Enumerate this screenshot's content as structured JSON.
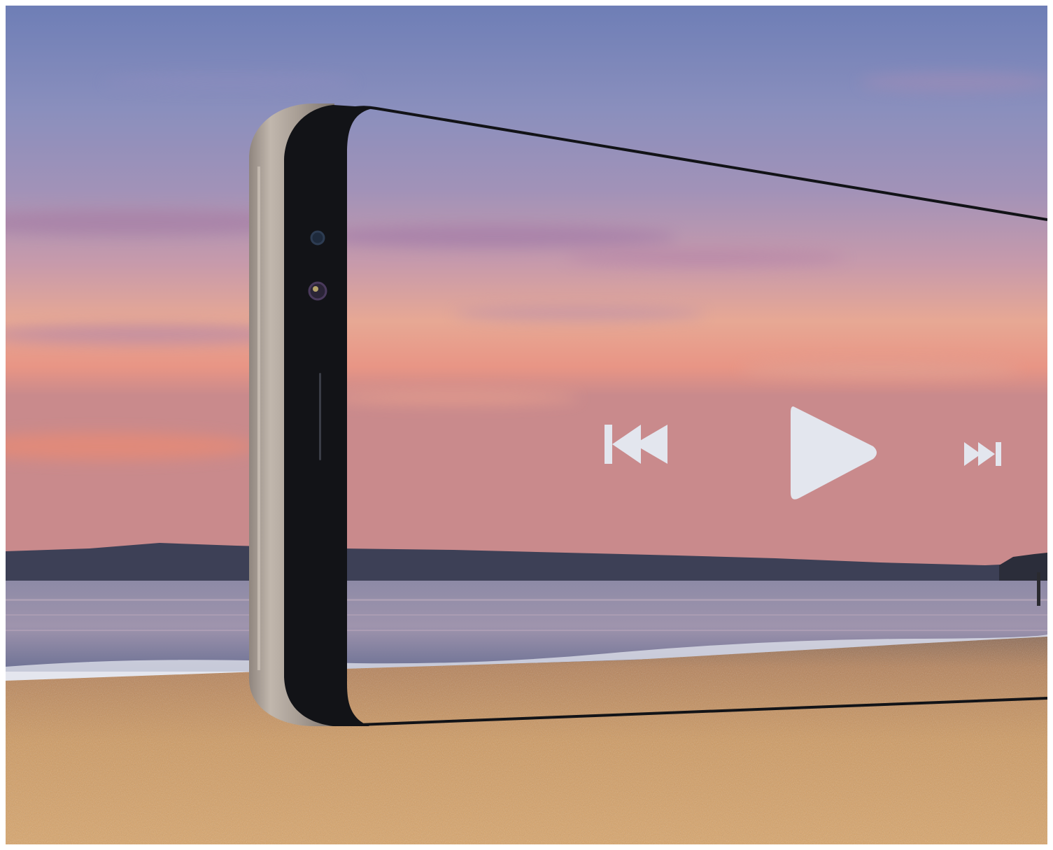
{
  "scene": {
    "setting": "beach-at-sunset",
    "device": "smartphone-bezel-edge"
  },
  "colors": {
    "sky_top": "#6f7fb4",
    "sky_mid": "#9a8db6",
    "sky_glow": "#e9a18f",
    "sky_horizon": "#d98a7c",
    "hills": "#3e4156",
    "sea": "#7d7ea0",
    "sea_light": "#b5a4b6",
    "sand": "#c9965c",
    "sand_dark": "#8a5f36",
    "bezel_frame": "#b4aaa1",
    "bezel_screen_edge": "#111318",
    "control_fill": "#e3e6ee"
  },
  "controls": {
    "rewind": "rewind-icon",
    "play": "play-icon",
    "fast_forward": "fast-forward-icon"
  }
}
